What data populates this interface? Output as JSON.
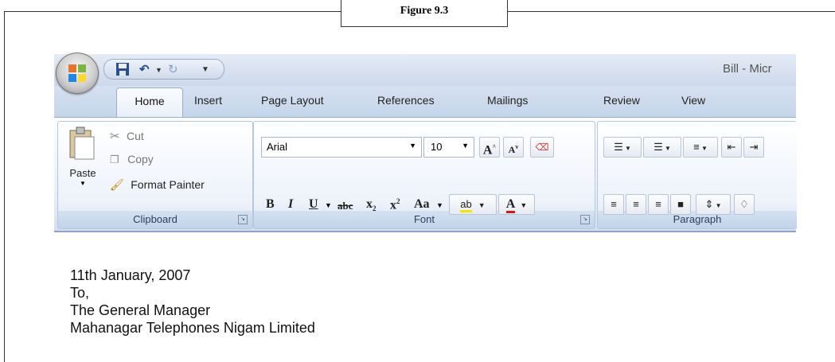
{
  "figure": {
    "label": "Figure 9.3"
  },
  "window": {
    "title": "Bill - Micr"
  },
  "qat": {
    "save_icon": "save-icon",
    "undo_icon": "undo-icon",
    "redo_icon": "redo-icon",
    "customize_icon": "customize-icon"
  },
  "tabs": [
    {
      "label": "Home",
      "active": true
    },
    {
      "label": "Insert"
    },
    {
      "label": "Page Layout"
    },
    {
      "label": "References"
    },
    {
      "label": "Mailings"
    },
    {
      "label": "Review"
    },
    {
      "label": "View"
    }
  ],
  "clipboard": {
    "paste_label": "Paste",
    "cut_label": "Cut",
    "copy_label": "Copy",
    "format_painter_label": "Format Painter",
    "group_label": "Clipboard"
  },
  "font": {
    "font_name": "Arial",
    "font_size": "10",
    "grow_label": "A",
    "shrink_label": "A",
    "bold_label": "B",
    "italic_label": "I",
    "underline_label": "U",
    "strikethrough_label": "abc",
    "subscript_label": "x",
    "superscript_label": "x",
    "change_case_label": "Aa",
    "highlight_label": "ab",
    "font_color_label": "A",
    "group_label": "Font"
  },
  "paragraph": {
    "group_label": "Paragraph"
  },
  "document": {
    "lines": [
      "11th January, 2007",
      "To,",
      "The General Manager",
      "Mahanagar Telephones Nigam Limited"
    ]
  },
  "colors": {
    "ribbon_blue": "#c4d4ea",
    "font_color_red": "#d21a1a",
    "highlight_yellow": "#f5e600"
  }
}
